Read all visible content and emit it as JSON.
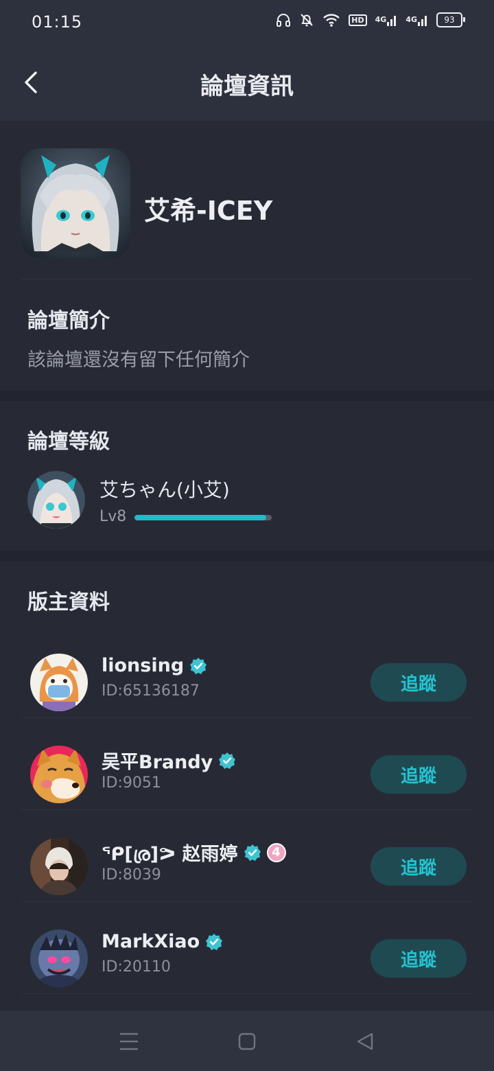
{
  "status_bar": {
    "time": "01:15",
    "battery": "93",
    "hd_label": "HD",
    "network1": "4G",
    "network2": "4G"
  },
  "header": {
    "title": "論壇資訊"
  },
  "forum": {
    "name": "艾希-ICEY"
  },
  "intro": {
    "title": "論壇簡介",
    "text": "該論壇還沒有留下任何簡介"
  },
  "level": {
    "title": "論壇等級",
    "name": "艾ちゃん(小艾)",
    "level_label": "Lv8",
    "progress": 0.96
  },
  "moderators": {
    "title": "版主資料",
    "follow_label": "追蹤",
    "items": [
      {
        "name": "lionsing",
        "id_text": "ID:65136187",
        "badge": ""
      },
      {
        "name": "吴平Brandy",
        "id_text": "ID:9051",
        "badge": ""
      },
      {
        "name": "ᕿ[ര്ര]ᕗ 赵雨婷",
        "id_text": "ID:8039",
        "badge": "4"
      },
      {
        "name": "MarkXiao",
        "id_text": "ID:20110",
        "badge": ""
      }
    ]
  },
  "colors": {
    "accent": "#23b9c9",
    "follow_bg": "#1f4a52",
    "background": "#22252f",
    "header": "#2d313d"
  }
}
